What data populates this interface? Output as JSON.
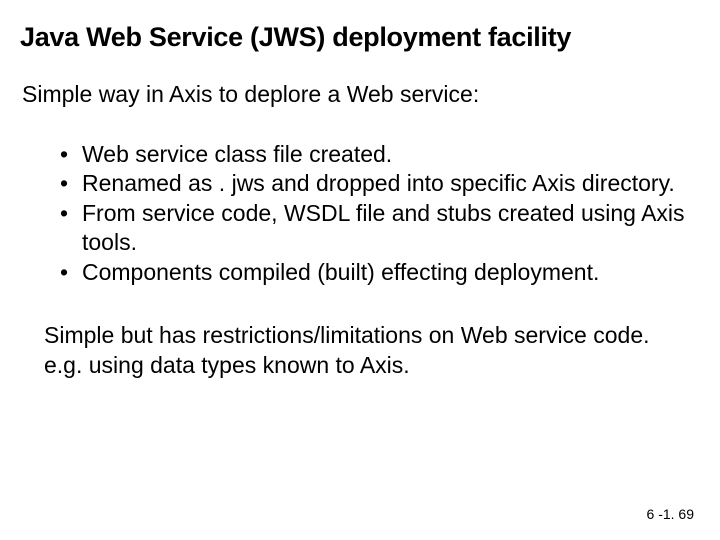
{
  "title": "Java Web Service (JWS) deployment facility",
  "intro": "Simple way in Axis to deplore a Web service:",
  "bullets": [
    "Web service class file created.",
    "Renamed as . jws and dropped into specific Axis directory.",
    "From service code, WSDL file and stubs created using Axis tools.",
    "Components compiled (built) effecting deployment."
  ],
  "closing": "Simple but has restrictions/limitations on Web service code. e.g. using data types known to Axis.",
  "page_number": "6 -1. 69"
}
